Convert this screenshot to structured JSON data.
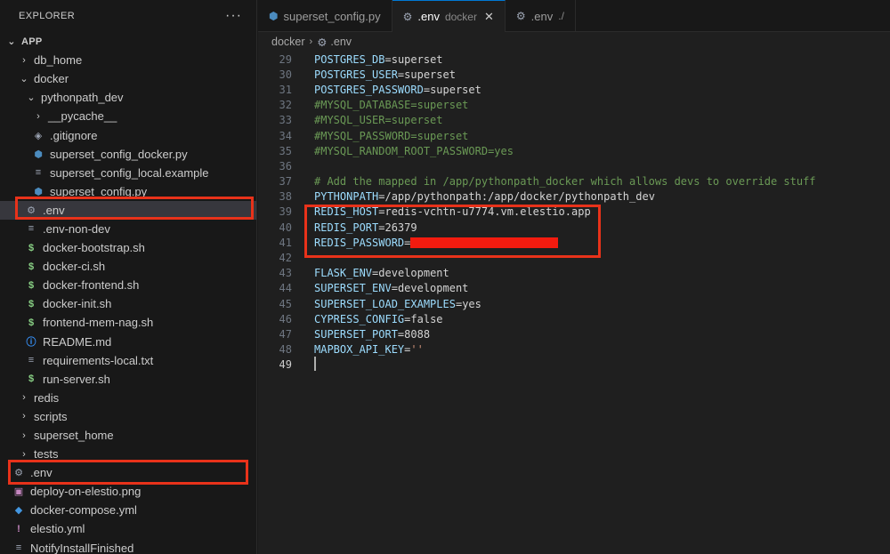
{
  "explorer": {
    "title": "EXPLORER",
    "more": "···",
    "root": "APP",
    "items": [
      {
        "label": "db_home",
        "type": "folder",
        "open": false,
        "depth": 1
      },
      {
        "label": "docker",
        "type": "folder",
        "open": true,
        "depth": 1
      },
      {
        "label": "pythonpath_dev",
        "type": "folder",
        "open": true,
        "depth": 2
      },
      {
        "label": "__pycache__",
        "type": "folder",
        "open": false,
        "depth": 3
      },
      {
        "label": ".gitignore",
        "type": "git",
        "depth": 3
      },
      {
        "label": "superset_config_docker.py",
        "type": "py",
        "depth": 3
      },
      {
        "label": "superset_config_local.example",
        "type": "lines",
        "depth": 3
      },
      {
        "label": "superset_config.py",
        "type": "py",
        "depth": 3
      },
      {
        "label": ".env",
        "type": "gear",
        "depth": 2,
        "selected": true
      },
      {
        "label": ".env-non-dev",
        "type": "lines",
        "depth": 2
      },
      {
        "label": "docker-bootstrap.sh",
        "type": "sh",
        "depth": 2
      },
      {
        "label": "docker-ci.sh",
        "type": "sh",
        "depth": 2
      },
      {
        "label": "docker-frontend.sh",
        "type": "sh",
        "depth": 2
      },
      {
        "label": "docker-init.sh",
        "type": "sh",
        "depth": 2
      },
      {
        "label": "frontend-mem-nag.sh",
        "type": "sh",
        "depth": 2
      },
      {
        "label": "README.md",
        "type": "info",
        "depth": 2
      },
      {
        "label": "requirements-local.txt",
        "type": "lines",
        "depth": 2
      },
      {
        "label": "run-server.sh",
        "type": "sh",
        "depth": 2
      },
      {
        "label": "redis",
        "type": "folder",
        "open": false,
        "depth": 1
      },
      {
        "label": "scripts",
        "type": "folder",
        "open": false,
        "depth": 1
      },
      {
        "label": "superset_home",
        "type": "folder",
        "open": false,
        "depth": 1
      },
      {
        "label": "tests",
        "type": "folder",
        "open": false,
        "depth": 1
      },
      {
        "label": ".env",
        "type": "gear",
        "depth": 0
      },
      {
        "label": "deploy-on-elestio.png",
        "type": "img",
        "depth": 0
      },
      {
        "label": "docker-compose.yml",
        "type": "docker",
        "depth": 0
      },
      {
        "label": "elestio.yml",
        "type": "yml",
        "depth": 0
      },
      {
        "label": "NotifyInstallFinished",
        "type": "lines",
        "depth": 0
      }
    ]
  },
  "tabs": [
    {
      "label": "superset_config.py",
      "desc": "",
      "icon": "py",
      "active": false
    },
    {
      "label": ".env",
      "desc": "docker",
      "icon": "gear",
      "active": true,
      "close": "✕"
    },
    {
      "label": ".env",
      "desc": "./",
      "icon": "gear",
      "active": false
    }
  ],
  "breadcrumb": {
    "folder": "docker",
    "file": ".env"
  },
  "editor": {
    "lines": [
      {
        "n": "29",
        "key": "POSTGRES_DB",
        "val": "superset"
      },
      {
        "n": "30",
        "key": "POSTGRES_USER",
        "val": "superset"
      },
      {
        "n": "31",
        "key": "POSTGRES_PASSWORD",
        "val": "superset"
      },
      {
        "n": "32",
        "comment": "#MYSQL_DATABASE=superset"
      },
      {
        "n": "33",
        "comment": "#MYSQL_USER=superset"
      },
      {
        "n": "34",
        "comment": "#MYSQL_PASSWORD=superset"
      },
      {
        "n": "35",
        "comment": "#MYSQL_RANDOM_ROOT_PASSWORD=yes"
      },
      {
        "n": "36"
      },
      {
        "n": "37",
        "comment": "# Add the mapped in /app/pythonpath_docker which allows devs to override stuff"
      },
      {
        "n": "38",
        "key": "PYTHONPATH",
        "val": "/app/pythonpath:/app/docker/pythonpath_dev"
      },
      {
        "n": "39",
        "key": "REDIS_HOST",
        "val": "redis-vchtn-u7774.vm.elestio.app"
      },
      {
        "n": "40",
        "key": "REDIS_PORT",
        "val": "26379"
      },
      {
        "n": "41",
        "key": "REDIS_PASSWORD",
        "val": "",
        "redacted": true
      },
      {
        "n": "42"
      },
      {
        "n": "43",
        "key": "FLASK_ENV",
        "val": "development"
      },
      {
        "n": "44",
        "key": "SUPERSET_ENV",
        "val": "development"
      },
      {
        "n": "45",
        "key": "SUPERSET_LOAD_EXAMPLES",
        "val": "yes"
      },
      {
        "n": "46",
        "key": "CYPRESS_CONFIG",
        "val": "false"
      },
      {
        "n": "47",
        "key": "SUPERSET_PORT",
        "val": "8088"
      },
      {
        "n": "48",
        "key": "MAPBOX_API_KEY",
        "val": "''",
        "string": true
      },
      {
        "n": "49",
        "cursor": true
      }
    ]
  },
  "colors": {
    "highlight": "#e8321a",
    "redaction": "#f31b0f",
    "accent": "#0078d4"
  }
}
